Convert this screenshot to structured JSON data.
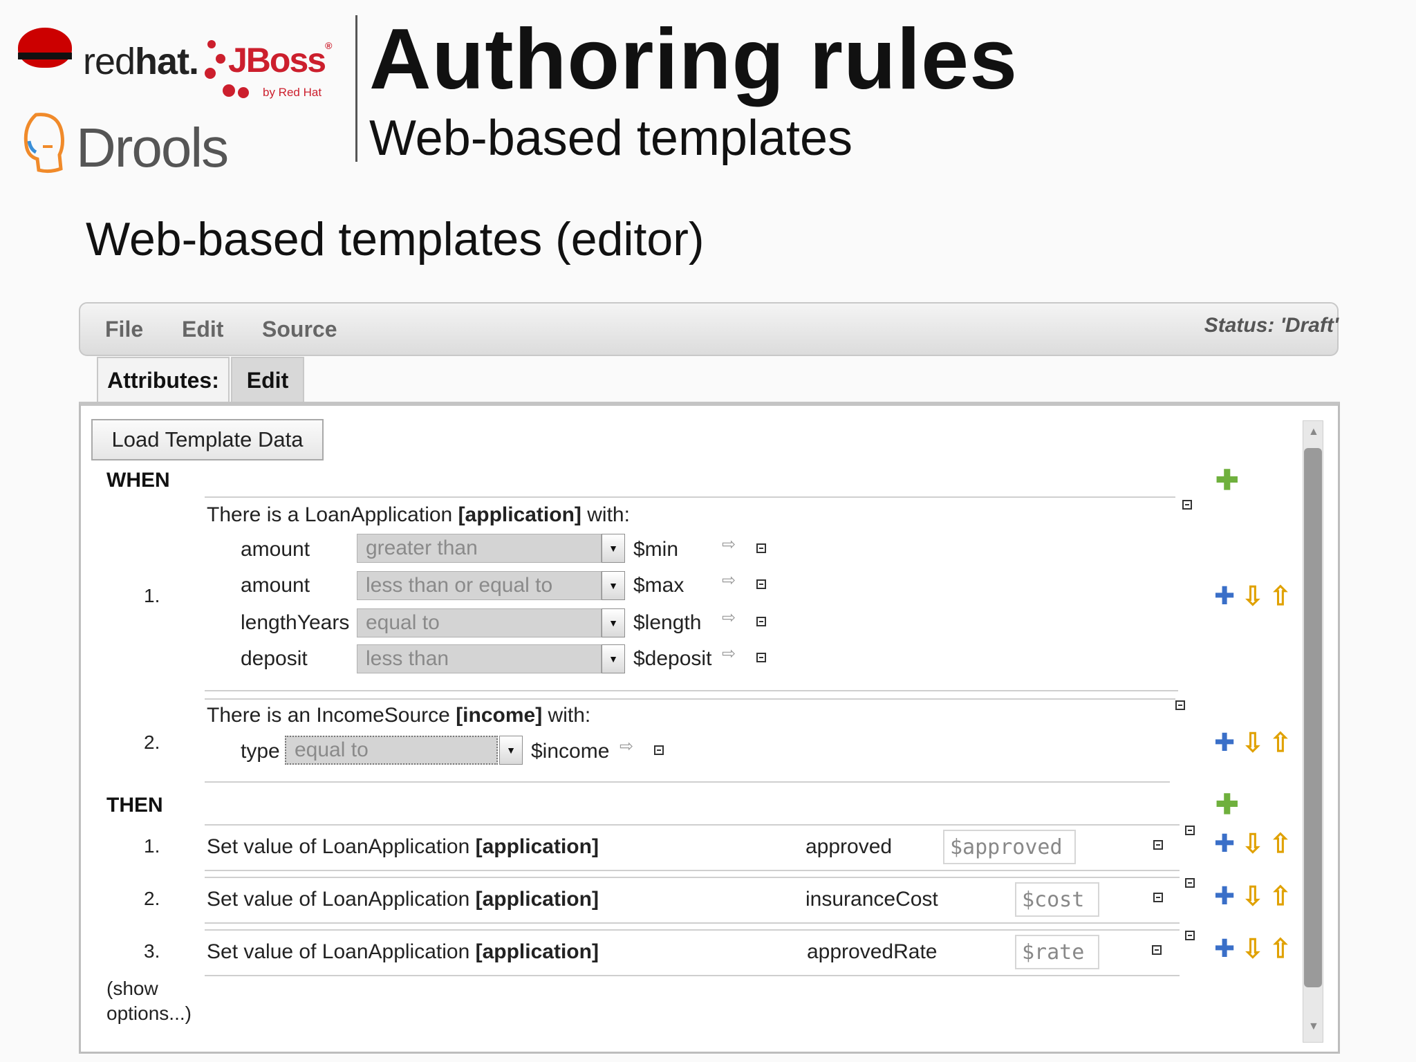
{
  "logos": {
    "redhat_a": "red",
    "redhat_b": "hat.",
    "jboss": "JBoss",
    "jboss_reg": "®",
    "jboss_by": "by Red Hat",
    "drools": "Drools"
  },
  "header": {
    "title": "Authoring rules",
    "subtitle": "Web-based templates"
  },
  "section_title": "Web-based templates (editor)",
  "menu": {
    "file": "File",
    "edit": "Edit",
    "source": "Source",
    "status": "Status: 'Draft'"
  },
  "tabs": {
    "attributes": "Attributes:",
    "edit": "Edit"
  },
  "load_button": "Load Template Data",
  "when_label": "WHEN",
  "then_label": "THEN",
  "show_options_1": "(show",
  "show_options_2": "options...)",
  "conditions": [
    {
      "number": "1.",
      "prefix": "There is a LoanApplication ",
      "binding": "[application]",
      "suffix": " with:",
      "rows": [
        {
          "field": "amount",
          "operator": "greater than",
          "variable": "$min"
        },
        {
          "field": "amount",
          "operator": "less than or equal to",
          "variable": "$max"
        },
        {
          "field": "lengthYears",
          "operator": "equal to",
          "variable": "$length"
        },
        {
          "field": "deposit",
          "operator": "less than",
          "variable": "$deposit"
        }
      ]
    },
    {
      "number": "2.",
      "prefix": "There is an IncomeSource ",
      "binding": "[income]",
      "suffix": " with:",
      "rows": [
        {
          "field": "type",
          "operator": "equal to",
          "variable": "$income"
        }
      ]
    }
  ],
  "actions": [
    {
      "number": "1.",
      "prefix": "Set value of LoanApplication ",
      "binding": "[application]",
      "field": "approved",
      "value": "$approved"
    },
    {
      "number": "2.",
      "prefix": "Set value of LoanApplication ",
      "binding": "[application]",
      "field": "insuranceCost",
      "value": "$cost"
    },
    {
      "number": "3.",
      "prefix": "Set value of LoanApplication ",
      "binding": "[application]",
      "field": "approvedRate",
      "value": "$rate"
    }
  ],
  "icons": {
    "add": "plus-icon",
    "move_down": "arrow-down-icon",
    "move_up": "arrow-up-icon",
    "remove": "minus-icon",
    "edit": "edit-value-icon"
  },
  "colors": {
    "add_green": "#6fb03d",
    "arrow_gold": "#e0a100",
    "redhat_red": "#cc0000"
  }
}
